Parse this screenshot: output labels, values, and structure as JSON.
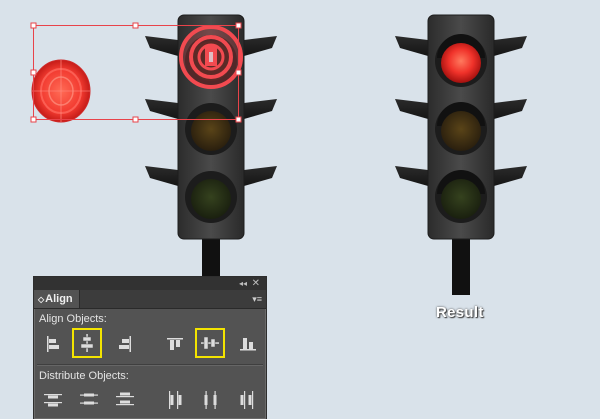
{
  "panel": {
    "tab_label": "Align",
    "tab_arrow": "◇",
    "collapse_icon": "◂◂",
    "close_icon": "✕",
    "menu_icon": "▾≡",
    "align_objects_label": "Align Objects:",
    "distribute_objects_label": "Distribute Objects:",
    "align_buttons": [
      {
        "name": "horizontal-align-left",
        "highlighted": false
      },
      {
        "name": "horizontal-align-center",
        "highlighted": true
      },
      {
        "name": "horizontal-align-right",
        "highlighted": false
      },
      {
        "name": "vertical-align-top",
        "highlighted": false
      },
      {
        "name": "vertical-align-center",
        "highlighted": true
      },
      {
        "name": "vertical-align-bottom",
        "highlighted": false
      }
    ],
    "distribute_buttons": [
      {
        "name": "vertical-distribute-top"
      },
      {
        "name": "vertical-distribute-center"
      },
      {
        "name": "vertical-distribute-bottom"
      },
      {
        "name": "horizontal-distribute-left"
      },
      {
        "name": "horizontal-distribute-center"
      },
      {
        "name": "horizontal-distribute-right"
      }
    ],
    "highlight_color": "#f4e400"
  },
  "result_label": "Result",
  "colors": {
    "background": "#d9e2ea",
    "selection": "#e8434a",
    "red_light": "#ff3b30",
    "traffic_body": "#3a3a3a"
  }
}
